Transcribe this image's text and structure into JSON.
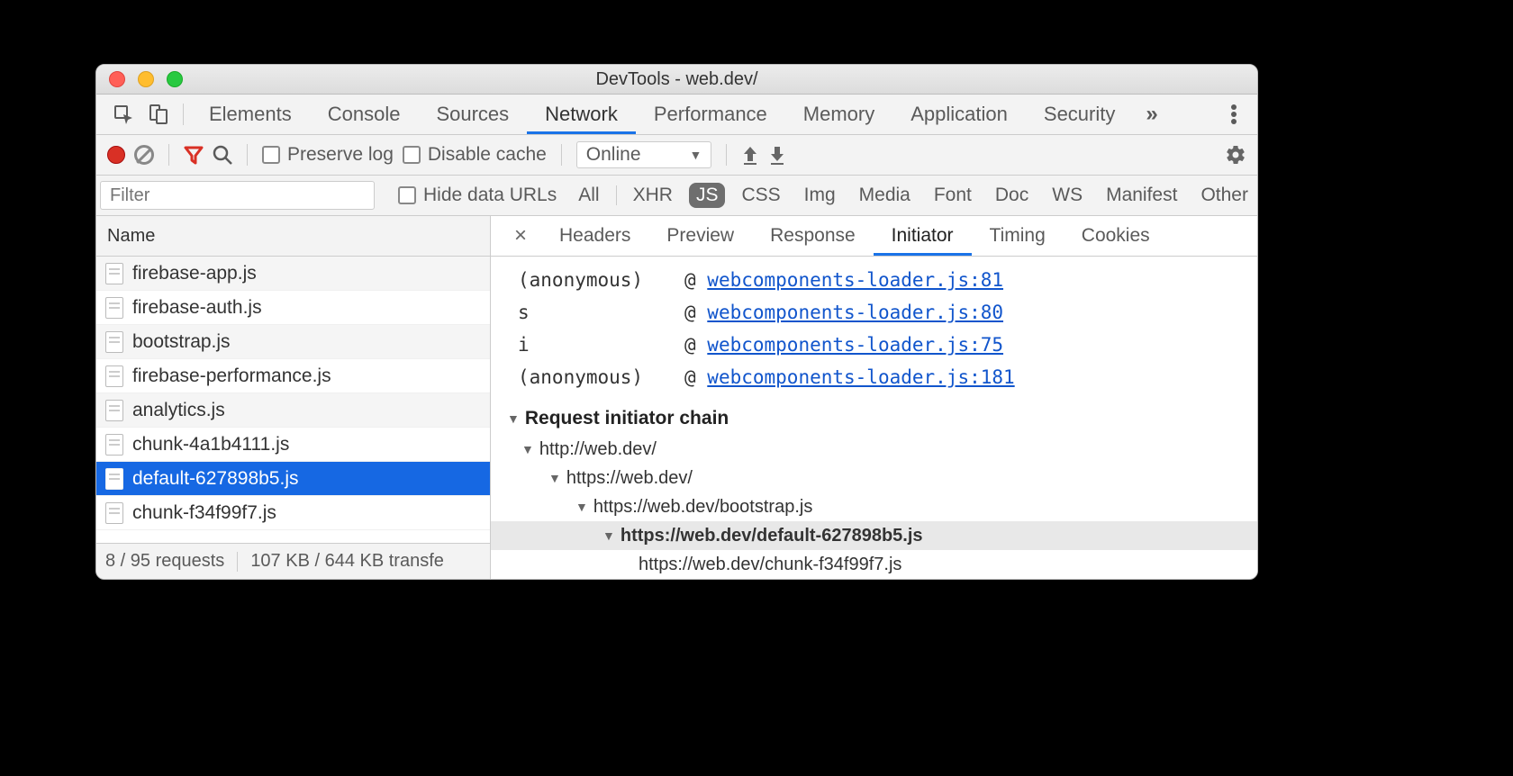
{
  "window": {
    "title": "DevTools - web.dev/"
  },
  "panels": [
    "Elements",
    "Console",
    "Sources",
    "Network",
    "Performance",
    "Memory",
    "Application",
    "Security"
  ],
  "active_panel": "Network",
  "network_toolbar": {
    "preserve_log": "Preserve log",
    "disable_cache": "Disable cache",
    "throttling": "Online"
  },
  "filter_row": {
    "placeholder": "Filter",
    "hide_data_urls": "Hide data URLs",
    "types": [
      "All",
      "XHR",
      "JS",
      "CSS",
      "Img",
      "Media",
      "Font",
      "Doc",
      "WS",
      "Manifest",
      "Other"
    ],
    "active_type": "JS"
  },
  "requests": {
    "header": "Name",
    "items": [
      {
        "name": "firebase-app.js",
        "selected": false
      },
      {
        "name": "firebase-auth.js",
        "selected": false
      },
      {
        "name": "bootstrap.js",
        "selected": false
      },
      {
        "name": "firebase-performance.js",
        "selected": false
      },
      {
        "name": "analytics.js",
        "selected": false
      },
      {
        "name": "chunk-4a1b4111.js",
        "selected": false
      },
      {
        "name": "default-627898b5.js",
        "selected": true
      },
      {
        "name": "chunk-f34f99f7.js",
        "selected": false
      }
    ],
    "status": {
      "count": "8 / 95 requests",
      "transfer": "107 KB / 644 KB transfe"
    }
  },
  "detail_tabs": [
    "Headers",
    "Preview",
    "Response",
    "Initiator",
    "Timing",
    "Cookies"
  ],
  "active_detail_tab": "Initiator",
  "stack": [
    {
      "fn": "(anonymous)",
      "src": "webcomponents-loader.js:81"
    },
    {
      "fn": "s",
      "src": "webcomponents-loader.js:80"
    },
    {
      "fn": "i",
      "src": "webcomponents-loader.js:75"
    },
    {
      "fn": "(anonymous)",
      "src": "webcomponents-loader.js:181"
    }
  ],
  "initiator_section": "Request initiator chain",
  "chain": [
    {
      "level": 0,
      "url": "http://web.dev/",
      "current": false,
      "expandable": true
    },
    {
      "level": 1,
      "url": "https://web.dev/",
      "current": false,
      "expandable": true
    },
    {
      "level": 2,
      "url": "https://web.dev/bootstrap.js",
      "current": false,
      "expandable": true
    },
    {
      "level": 3,
      "url": "https://web.dev/default-627898b5.js",
      "current": true,
      "expandable": true
    },
    {
      "level": 4,
      "url": "https://web.dev/chunk-f34f99f7.js",
      "current": false,
      "expandable": false
    }
  ]
}
